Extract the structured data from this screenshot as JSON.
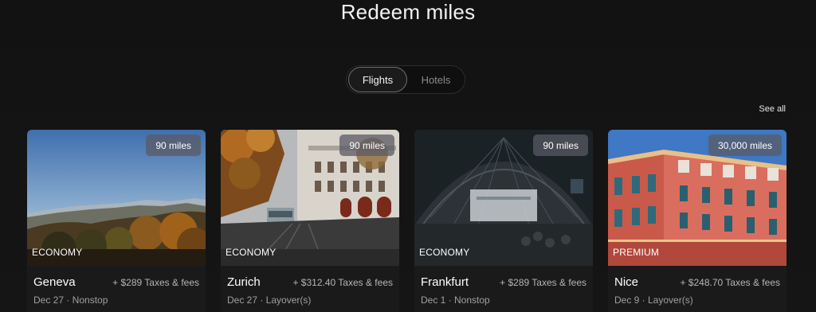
{
  "page": {
    "title": "Redeem miles"
  },
  "tabs": [
    {
      "label": "Flights",
      "active": true
    },
    {
      "label": "Hotels",
      "active": false
    }
  ],
  "see_all": "See all",
  "cards": [
    {
      "city": "Geneva",
      "miles": "90 miles",
      "cabin": "ECONOMY",
      "price": "+ $289 Taxes & fees",
      "details": "Dec 27 · Nonstop"
    },
    {
      "city": "Zurich",
      "miles": "90 miles",
      "cabin": "ECONOMY",
      "price": "+ $312.40 Taxes & fees",
      "details": "Dec 27 · Layover(s)"
    },
    {
      "city": "Frankfurt",
      "miles": "90 miles",
      "cabin": "ECONOMY",
      "price": "+ $289 Taxes & fees",
      "details": "Dec 1 · Nonstop"
    },
    {
      "city": "Nice",
      "miles": "30,000 miles",
      "cabin": "PREMIUM",
      "price": "+ $248.70 Taxes & fees",
      "details": "Dec 9 · Layover(s)"
    }
  ]
}
